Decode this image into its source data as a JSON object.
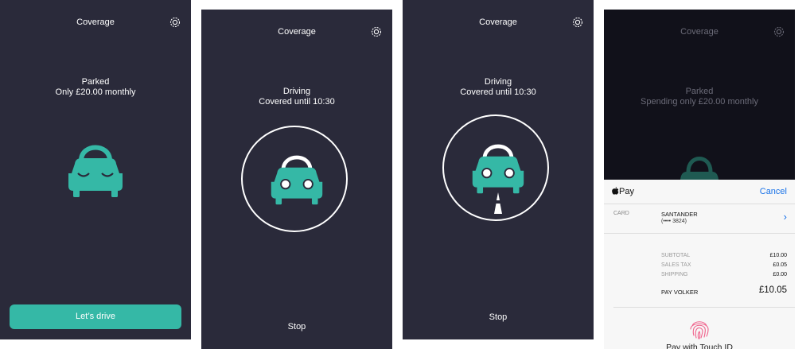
{
  "screens": [
    {
      "title": "Coverage",
      "status_line1": "Parked",
      "status_line2": "Only £20.00 monthly",
      "button_label": "Let’s drive"
    },
    {
      "title": "Coverage",
      "status_line1": "Driving",
      "status_line2": "Covered until 10:30",
      "stop_label": "Stop"
    },
    {
      "title": "Coverage",
      "status_line1": "Driving",
      "status_line2": "Covered until 10:30",
      "stop_label": "Stop"
    },
    {
      "title": "Coverage",
      "status_line1": "Parked",
      "status_line2": "Spending only £20.00 monthly"
    }
  ],
  "apple_pay": {
    "brand": "Pay",
    "cancel_label": "Cancel",
    "card_label": "CARD",
    "card_name": "SANTANDER",
    "card_number": "(•••• 3824)",
    "subtotal_label": "SUBTOTAL",
    "subtotal": "£10.00",
    "tax_label": "SALES TAX",
    "tax": "£0.05",
    "shipping_label": "SHIPPING",
    "shipping": "£0.00",
    "pay_label": "PAY VOLKER",
    "total": "£10.05",
    "touch_label": "Pay with Touch ID"
  },
  "colors": {
    "background": "#2a2a3a",
    "accent": "#35b8a6",
    "fingerprint": "#f0608a",
    "link": "#1a73e8"
  }
}
